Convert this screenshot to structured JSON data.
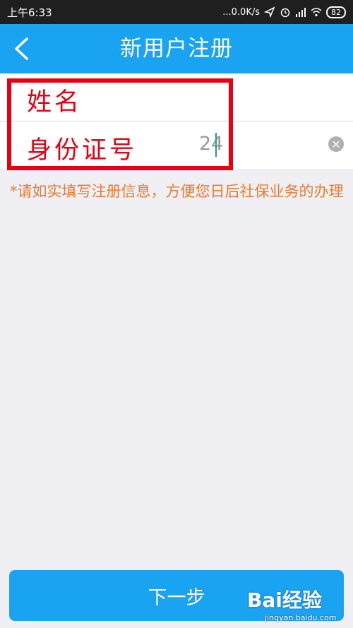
{
  "status_bar": {
    "time": "上午6:33",
    "network_speed": "...0.0K/s",
    "battery": "82"
  },
  "header": {
    "title": "新用户注册"
  },
  "form": {
    "name_label": "姓名",
    "id_label": "身份证号",
    "id_value": "24"
  },
  "notice": "*请如实填写注册信息，方便您日后社保业务的办理",
  "next_button": "下一步",
  "watermark": {
    "logo": "Bai经验",
    "url": "jingyan.baidu.com"
  },
  "colors": {
    "accent": "#1aa3f0",
    "highlight": "#e60012",
    "notice": "#ee7a2f"
  }
}
